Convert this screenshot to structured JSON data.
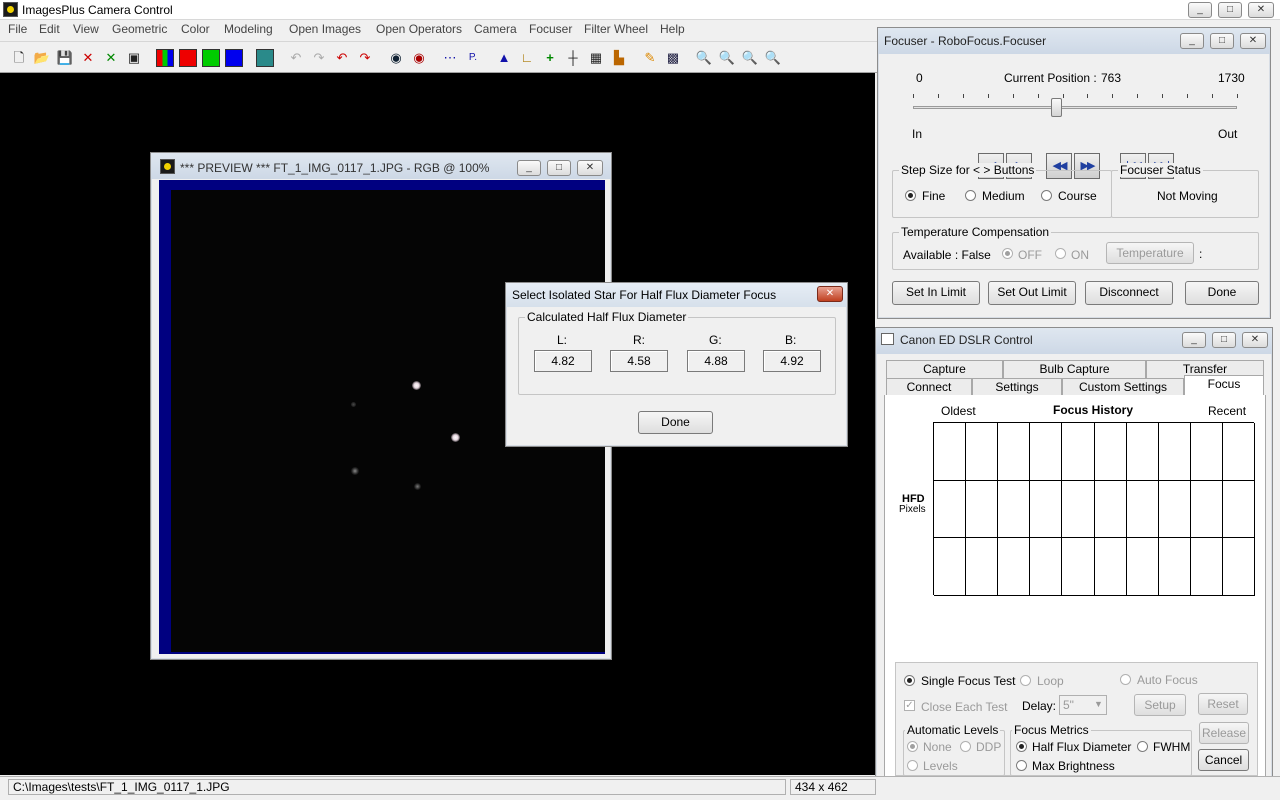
{
  "app": {
    "title": "ImagesPlus Camera Control",
    "menu": [
      "File",
      "Edit",
      "View",
      "Geometric",
      "Color",
      "Modeling",
      "Open Images",
      "Open Operators",
      "Camera",
      "Focuser",
      "Filter Wheel",
      "Help"
    ],
    "window_buttons": [
      "_",
      "□",
      "✕"
    ]
  },
  "toolbar": {
    "icons": [
      "new-icon",
      "open-icon",
      "save-icon",
      "close-x-icon",
      "green-x-icon",
      "window-icon",
      "rgb-icon",
      "red-channel-icon",
      "green-channel-icon",
      "blue-channel-icon",
      "grid-icon",
      "undo-gray-icon",
      "redo-gray-icon",
      "undo-icon",
      "redo-icon",
      "circle-icon",
      "circle-red-icon",
      "dots-icon",
      "p-icon",
      "histogram-icon",
      "levels-icon",
      "plus-green-icon",
      "crosshair-icon",
      "calculator-icon",
      "chart-icon",
      "pencil-icon",
      "pattern-icon",
      "zoom-in-icon",
      "zoom-out-icon",
      "zoom-fit-icon",
      "zoom-icon"
    ]
  },
  "status_bar": {
    "path": "C:\\Images\\tests\\FT_1_IMG_0117_1.JPG",
    "dimensions": "434 x 462"
  },
  "preview": {
    "title": "*** PREVIEW *** FT_1_IMG_0117_1.JPG - RGB @ 100%"
  },
  "hfd_dialog": {
    "title": "Select Isolated Star For Half Flux Diameter Focus",
    "group_label": "Calculated Half Flux Diameter",
    "channels": [
      {
        "label": "L:",
        "value": "4.82"
      },
      {
        "label": "R:",
        "value": "4.58"
      },
      {
        "label": "G:",
        "value": "4.88"
      },
      {
        "label": "B:",
        "value": "4.92"
      }
    ],
    "done": "Done"
  },
  "focuser": {
    "title": "Focuser - RoboFocus.Focuser",
    "min": "0",
    "max": "1730",
    "position_label": "Current Position :",
    "position": "763",
    "position_value": 763,
    "in_label": "In",
    "out_label": "Out",
    "step_group": "Step Size for < > Buttons",
    "step_options": [
      "Fine",
      "Medium",
      "Course"
    ],
    "step_selected": "Fine",
    "status_group": "Focuser Status",
    "status": "Not Moving",
    "temp_group": "Temperature Compensation",
    "temp_available": "Available : False",
    "temp_off": "OFF",
    "temp_on": "ON",
    "temp_button": "Temperature",
    "temp_colon": ":",
    "buttons": [
      "Set In Limit",
      "Set Out Limit",
      "Disconnect",
      "Done"
    ]
  },
  "canon": {
    "title": "Canon ED DSLR Control",
    "tabs_row1": [
      "Capture",
      "Bulb Capture",
      "Transfer"
    ],
    "tabs_row2": [
      "Connect",
      "Settings",
      "Custom Settings",
      "Focus"
    ],
    "selected_tab": "Focus",
    "oldest": "Oldest",
    "history_title": "Focus History",
    "recent": "Recent",
    "y_label": "HFD",
    "y_unit": "Pixels",
    "single_test": "Single Focus Test",
    "loop": "Loop",
    "auto_focus": "Auto Focus",
    "close_each": "Close Each Test",
    "delay_label": "Delay:",
    "delay_value": "5\"",
    "setup": "Setup",
    "reset": "Reset",
    "auto_levels_group": "Automatic Levels",
    "levels_none": "None",
    "levels_ddp": "DDP",
    "levels_levels": "Levels",
    "metrics_group": "Focus Metrics",
    "metric_hfd": "Half Flux Diameter",
    "metric_fwhm": "FWHM",
    "metric_max": "Max Brightness",
    "release": "Release",
    "cancel": "Cancel"
  }
}
